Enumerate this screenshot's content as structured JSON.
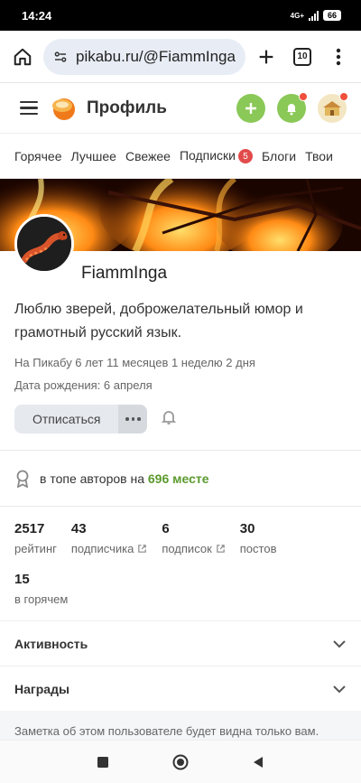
{
  "status": {
    "time": "14:24",
    "network": "4G+",
    "battery": "66"
  },
  "browser": {
    "url": "pikabu.ru/@FiammInga",
    "tab_count": "10"
  },
  "header": {
    "title": "Профиль"
  },
  "tabs": [
    {
      "label": "Горячее"
    },
    {
      "label": "Лучшее"
    },
    {
      "label": "Свежее"
    },
    {
      "label": "Подписки",
      "badge": "5"
    },
    {
      "label": "Блоги"
    },
    {
      "label": "Твои"
    }
  ],
  "profile": {
    "name": "FiammInga",
    "bio": "Люблю зверей, доброжелательный юмор и грамотный русский язык.",
    "on_site": "На Пикабу 6 лет 11 месяцев 1 неделю 2 дня",
    "birthday": "Дата рождения: 6 апреля",
    "unsubscribe_label": "Отписаться"
  },
  "top": {
    "prefix": "в топе авторов на",
    "place": "696 месте"
  },
  "stats": [
    {
      "value": "2517",
      "label": "рейтинг"
    },
    {
      "value": "43",
      "label": "подписчика"
    },
    {
      "value": "6",
      "label": "подписок"
    },
    {
      "value": "30",
      "label": "постов"
    }
  ],
  "hot": {
    "value": "15",
    "label": "в горячем"
  },
  "sections": {
    "activity": "Активность",
    "awards": "Награды"
  },
  "note": "Заметка об этом пользователе будет видна только вам. Нажмите, чтобы ввести текст.",
  "colors": {
    "accent_green": "#8ac858",
    "badge_red": "#e24b4b",
    "top_place": "#5b9a2e"
  }
}
